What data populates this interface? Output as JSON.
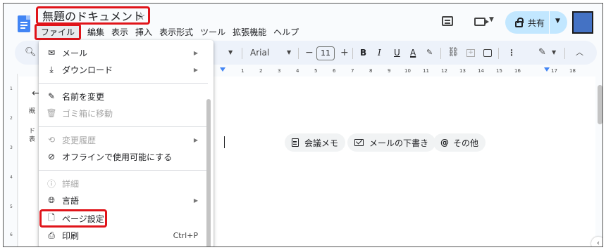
{
  "doc": {
    "title": "無題のドキュメント",
    "star": "☆"
  },
  "menubar": [
    "ファイル",
    "編集",
    "表示",
    "挿入",
    "表示形式",
    "ツール",
    "拡張機能",
    "ヘルプ"
  ],
  "header": {
    "share_label": "共有",
    "avatar_color": "#4472c4"
  },
  "toolbar": {
    "font_name": "Arial",
    "font_size": "11",
    "bold": "B",
    "italic": "I",
    "underline": "U",
    "text_color": "A",
    "more": "⋮"
  },
  "ruler": {
    "labels": [
      "1",
      "2",
      "3",
      "4",
      "5",
      "6",
      "7",
      "8",
      "9",
      "10",
      "11",
      "12",
      "13",
      "14",
      "15",
      "16",
      "17",
      "18"
    ]
  },
  "outline": {
    "frag1": "概",
    "frag2": "ド",
    "frag3": "表"
  },
  "vruler": [
    "1",
    "2",
    "3",
    "4",
    "5",
    "6"
  ],
  "chips": [
    {
      "label": "会議メモ",
      "icon": "document-icon"
    },
    {
      "label": "メールの下書き",
      "icon": "mail-icon"
    },
    {
      "label": "その他",
      "icon": "at-icon"
    }
  ],
  "file_menu": {
    "items": [
      {
        "label": "メール",
        "icon": "mail-icon",
        "submenu": true,
        "disabled": false
      },
      {
        "label": "ダウンロード",
        "icon": "download-icon",
        "submenu": true,
        "disabled": false
      },
      {
        "label": "名前を変更",
        "icon": "rename-icon",
        "submenu": false,
        "disabled": false
      },
      {
        "label": "ゴミ箱に移動",
        "icon": "trash-icon",
        "submenu": false,
        "disabled": true
      },
      {
        "label": "変更履歴",
        "icon": "history-icon",
        "submenu": true,
        "disabled": true
      },
      {
        "label": "オフラインで使用可能にする",
        "icon": "offline-icon",
        "submenu": false,
        "disabled": false
      },
      {
        "label": "詳細",
        "icon": "info-icon",
        "submenu": false,
        "disabled": true
      },
      {
        "label": "言語",
        "icon": "globe-icon",
        "submenu": true,
        "disabled": false
      },
      {
        "label": "ページ設定",
        "icon": "page-icon",
        "submenu": false,
        "disabled": false
      },
      {
        "label": "印刷",
        "icon": "print-icon",
        "submenu": false,
        "disabled": false,
        "shortcut": "Ctrl+P"
      }
    ]
  },
  "colors": {
    "highlight": "#e0141a",
    "brand": "#4285f4",
    "share_bg": "#c2e7ff"
  }
}
